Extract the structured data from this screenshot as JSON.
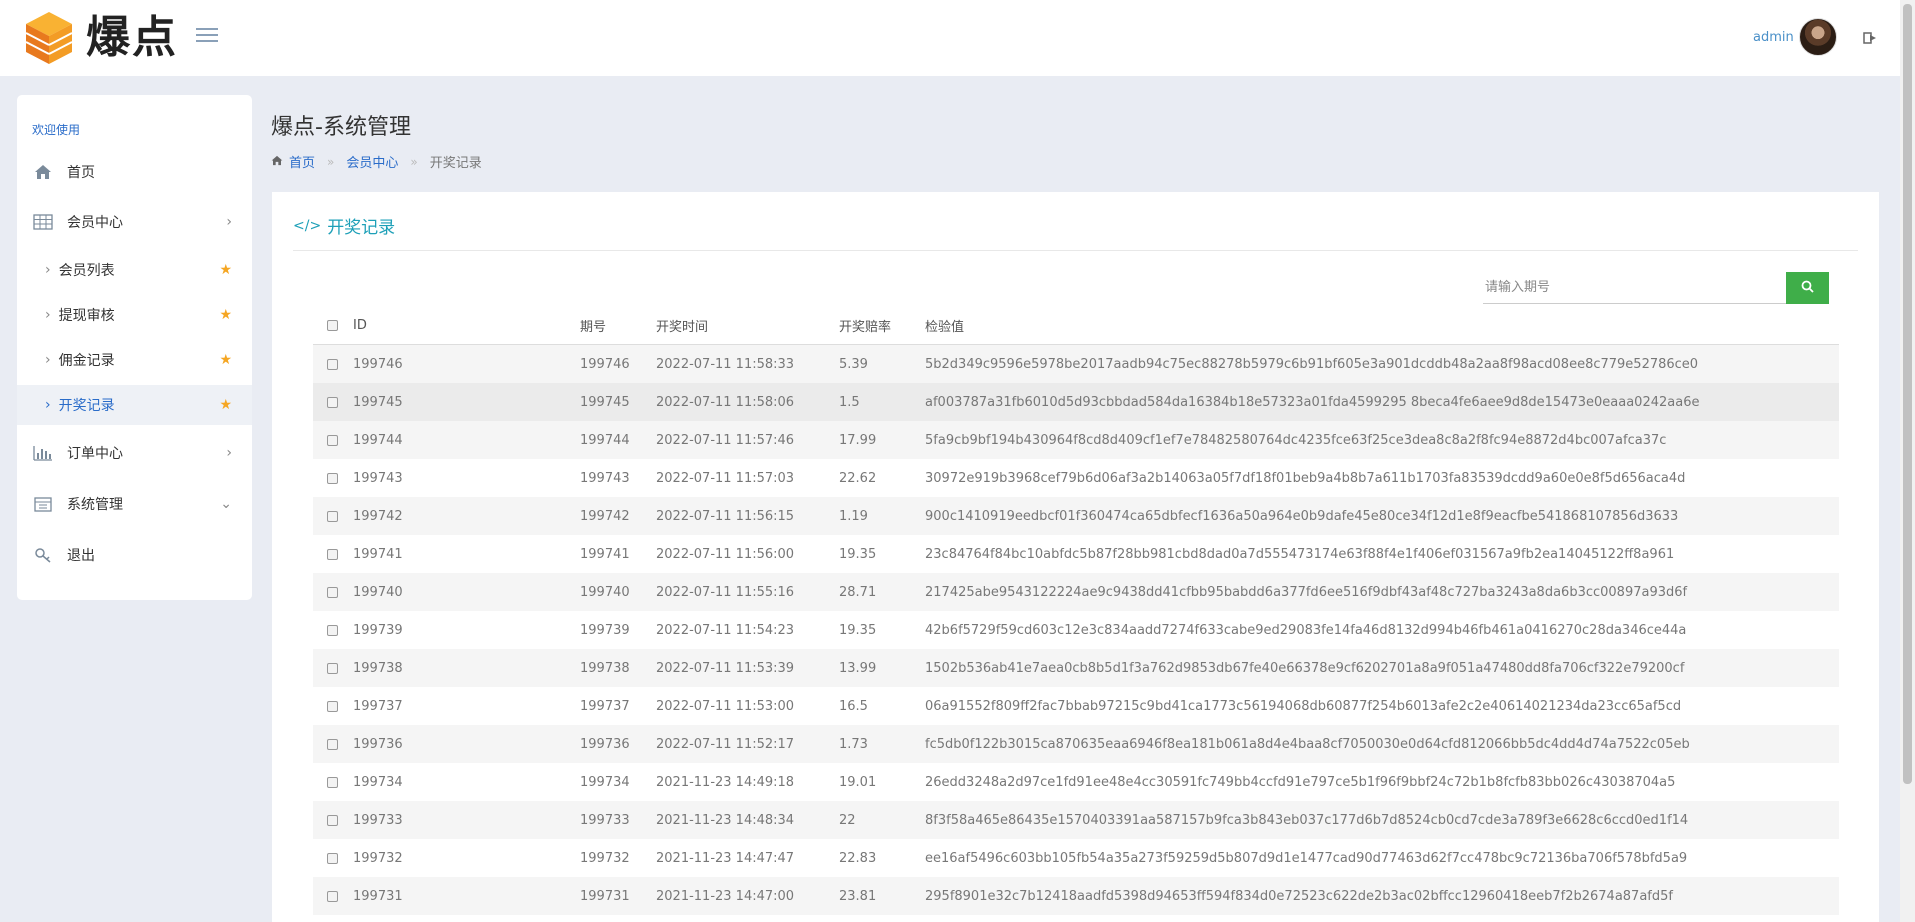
{
  "app": {
    "logo_text": "爆点",
    "user_name": "admin"
  },
  "sidebar": {
    "welcome": "欢迎使用",
    "items": [
      {
        "label": "首页",
        "icon": "home-icon"
      },
      {
        "label": "会员中心",
        "icon": "table-icon",
        "expanded": true
      },
      {
        "label": "订单中心",
        "icon": "bar-chart-icon"
      },
      {
        "label": "系统管理",
        "icon": "calendar-icon"
      },
      {
        "label": "退出",
        "icon": "key-icon"
      }
    ],
    "subitems": [
      {
        "label": "会员列表"
      },
      {
        "label": "提现审核"
      },
      {
        "label": "佣金记录"
      },
      {
        "label": "开奖记录",
        "active": true
      }
    ]
  },
  "page": {
    "title": "爆点-系统管理",
    "breadcrumb": [
      "首页",
      "会员中心",
      "开奖记录"
    ],
    "sep": "»"
  },
  "panel": {
    "title": "开奖记录",
    "search_placeholder": "请输入期号"
  },
  "table": {
    "headers": [
      "ID",
      "期号",
      "开奖时间",
      "开奖赔率",
      "检验值"
    ],
    "rows": [
      {
        "id": "199746",
        "qh": "199746",
        "time": "2022-07-11 11:58:33",
        "rate": "5.39",
        "hash": "5b2d349c9596e5978be2017aadb94c75ec88278b5979c6b91bf605e3a901dcddb48a2aa8f98acd08ee8c779e52786ce0"
      },
      {
        "id": "199745",
        "qh": "199745",
        "time": "2022-07-11 11:58:06",
        "rate": "1.5",
        "hash": "af003787a31fb6010d5d93cbbdad584da16384b18e57323a01fda4599295 8beca4fe6aee9d8de15473e0eaaa0242aa6e"
      },
      {
        "id": "199744",
        "qh": "199744",
        "time": "2022-07-11 11:57:46",
        "rate": "17.99",
        "hash": "5fa9cb9bf194b430964f8cd8d409cf1ef7e78482580764dc4235fce63f25ce3dea8c8a2f8fc94e8872d4bc007afca37c"
      },
      {
        "id": "199743",
        "qh": "199743",
        "time": "2022-07-11 11:57:03",
        "rate": "22.62",
        "hash": "30972e919b3968cef79b6d06af3a2b14063a05f7df18f01beb9a4b8b7a611b1703fa83539dcdd9a60e0e8f5d656aca4d"
      },
      {
        "id": "199742",
        "qh": "199742",
        "time": "2022-07-11 11:56:15",
        "rate": "1.19",
        "hash": "900c1410919eedbcf01f360474ca65dbfecf1636a50a964e0b9dafe45e80ce34f12d1e8f9eacfbe541868107856d3633"
      },
      {
        "id": "199741",
        "qh": "199741",
        "time": "2022-07-11 11:56:00",
        "rate": "19.35",
        "hash": "23c84764f84bc10abfdc5b87f28bb981cbd8dad0a7d555473174e63f88f4e1f406ef031567a9fb2ea14045122ff8a961"
      },
      {
        "id": "199740",
        "qh": "199740",
        "time": "2022-07-11 11:55:16",
        "rate": "28.71",
        "hash": "217425abe9543122224ae9c9438dd41cfbb95babdd6a377fd6ee516f9dbf43af48c727ba3243a8da6b3cc00897a93d6f"
      },
      {
        "id": "199739",
        "qh": "199739",
        "time": "2022-07-11 11:54:23",
        "rate": "19.35",
        "hash": "42b6f5729f59cd603c12e3c834aadd7274f633cabe9ed29083fe14fa46d8132d994b46fb461a0416270c28da346ce44a"
      },
      {
        "id": "199738",
        "qh": "199738",
        "time": "2022-07-11 11:53:39",
        "rate": "13.99",
        "hash": "1502b536ab41e7aea0cb8b5d1f3a762d9853db67fe40e66378e9cf6202701a8a9f051a47480dd8fa706cf322e79200cf"
      },
      {
        "id": "199737",
        "qh": "199737",
        "time": "2022-07-11 11:53:00",
        "rate": "16.5",
        "hash": "06a91552f809ff2fac7bbab97215c9bd41ca1773c56194068db60877f254b6013afe2c2e40614021234da23cc65af5cd"
      },
      {
        "id": "199736",
        "qh": "199736",
        "time": "2022-07-11 11:52:17",
        "rate": "1.73",
        "hash": "fc5db0f122b3015ca870635eaa6946f8ea181b061a8d4e4baa8cf7050030e0d64cfd812066bb5dc4dd4d74a7522c05eb"
      },
      {
        "id": "199734",
        "qh": "199734",
        "time": "2021-11-23 14:49:18",
        "rate": "19.01",
        "hash": "26edd3248a2d97ce1fd91ee48e4cc30591fc749bb4ccfd91e797ce5b1f96f9bbf24c72b1b8fcfb83bb026c43038704a5"
      },
      {
        "id": "199733",
        "qh": "199733",
        "time": "2021-11-23 14:48:34",
        "rate": "22",
        "hash": "8f3f58a465e86435e1570403391aa587157b9fca3b843eb037c177d6b7d8524cb0cd7cde3a789f3e6628c6ccd0ed1f14"
      },
      {
        "id": "199732",
        "qh": "199732",
        "time": "2021-11-23 14:47:47",
        "rate": "22.83",
        "hash": "ee16af5496c603bb105fb54a35a273f59259d5b807d9d1e1477cad90d77463d62f7cc478bc9c72136ba706f578bfd5a9"
      },
      {
        "id": "199731",
        "qh": "199731",
        "time": "2021-11-23 14:47:00",
        "rate": "23.81",
        "hash": "295f8901e32c7b12418aadfd5398d94653ff594f834d0e72523c622de2b3ac02bffcc12960418eeb7f2b2674a87afd5f"
      }
    ]
  },
  "colors": {
    "accent": "#2a6cc9",
    "title_teal": "#1ea0b8",
    "search_green": "#3fae49",
    "star": "#f5a623"
  }
}
